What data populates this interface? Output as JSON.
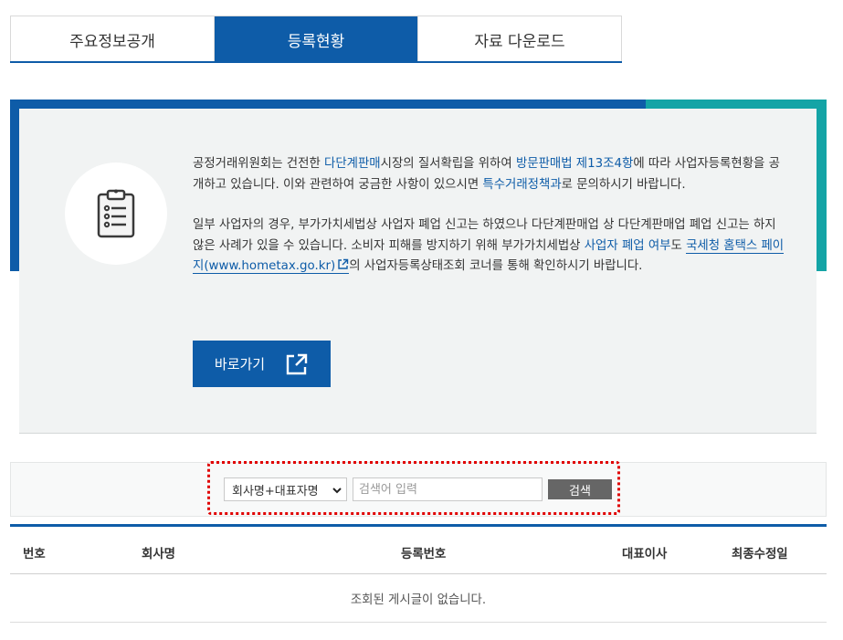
{
  "tabs": [
    {
      "label": "주요정보공개",
      "active": false
    },
    {
      "label": "등록현황",
      "active": true
    },
    {
      "label": "자료 다운로드",
      "active": false
    }
  ],
  "info": {
    "p1_a": "공정거래위원회는 건전한 ",
    "p1_hl1": "다단계판매",
    "p1_b": "시장의 질서확립을 위하여 ",
    "p1_hl2": "방문판매법 제13조4항",
    "p1_c": "에 따라 사업자등록현황을 공개하고 있습니다. 이와 관련하여 궁금한 사항이 있으시면 ",
    "p1_hl3": "특수거래정책과",
    "p1_d": "로 문의하시기 바랍니다.",
    "p2_a": "일부 사업자의 경우, 부가가치세법상 사업자 폐업 신고는 하였으나 다단계판매업 상 다단계판매업 폐업 신고는 하지 않은 사례가 있을 수 있습니다. 소비자 피해를 방지하기 위해 부가가치세법상 ",
    "p2_hl1": "사업자 폐업 여부",
    "p2_b": "도 ",
    "p2_link": "국세청 홈택스 페이지(www.hometax.go.kr)",
    "p2_c": "의 사업자등록상태조회 코너를 통해 확인하시기 바랍니다.",
    "go_button": "바로가기",
    "icon": "clipboard-icon"
  },
  "search": {
    "select_value": "회사명+대표자명",
    "placeholder": "검색어 입력",
    "button": "검색"
  },
  "table": {
    "headers": [
      "번호",
      "회사명",
      "등록번호",
      "대표이사",
      "최종수정일"
    ],
    "empty_message": "조회된 게시글이 없습니다."
  },
  "colors": {
    "primary": "#0e5ca8",
    "teal": "#14a4a6",
    "box_bg": "#f1f3f3",
    "highlight_border": "#e00000"
  }
}
